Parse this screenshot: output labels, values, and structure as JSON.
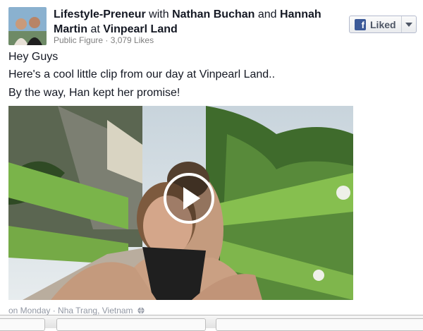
{
  "post": {
    "page_name": "Lifestyle-Preneur",
    "with_word": "with",
    "tag1": "Nathan Buchan",
    "and_word": "and",
    "tag2": "Hannah Martin",
    "at_word": "at",
    "location": "Vinpearl Land",
    "meta": "Public Figure · 3,079 Likes",
    "liked_label": "Liked",
    "lines": [
      "Hey Guys",
      "Here's a cool little clip from our day at Vinpearl Land..",
      "By the way, Han kept her promise!"
    ],
    "footer": "on Monday · Nha Trang, Vietnam"
  },
  "colors": {
    "brand": "#3b5998",
    "meta": "#7f7f7f"
  },
  "icons": {
    "like_button": "facebook-f-icon",
    "dropdown": "triangle-down-icon",
    "video": "play-icon",
    "privacy": "globe-icon"
  }
}
